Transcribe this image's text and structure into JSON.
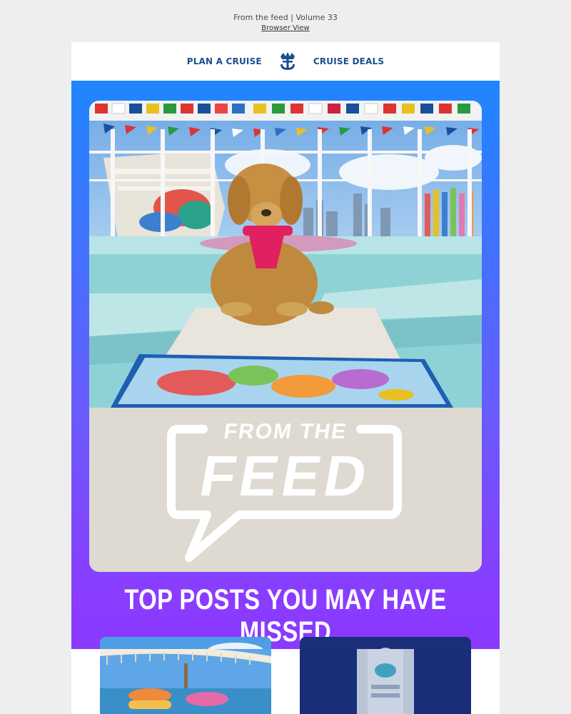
{
  "preheader": {
    "title": "From the feed | Volume 33",
    "browser_view": "Browser View"
  },
  "nav": {
    "plan_label": "PLAN A CRUISE",
    "deals_label": "CRUISE DEALS",
    "logo_icon": "crown-anchor-icon"
  },
  "hero": {
    "logo_line1": "FROM THE",
    "logo_line2": "FEED",
    "headline": "TOP POSTS YOU MAY HAVE MISSED"
  },
  "colors": {
    "nav_text": "#1a4f8c",
    "gradient_top": "#1f86ff",
    "gradient_bottom": "#8b37ff"
  }
}
